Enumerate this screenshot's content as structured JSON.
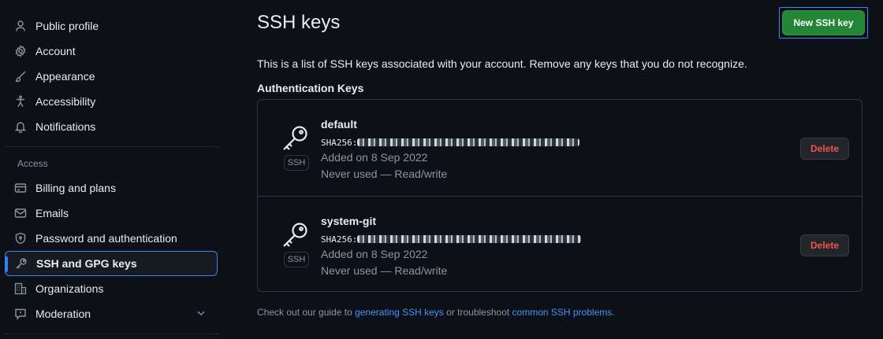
{
  "sidebar": {
    "items": [
      {
        "label": "Public profile",
        "icon": "person-icon"
      },
      {
        "label": "Account",
        "icon": "gear-icon"
      },
      {
        "label": "Appearance",
        "icon": "paintbrush-icon"
      },
      {
        "label": "Accessibility",
        "icon": "accessibility-icon"
      },
      {
        "label": "Notifications",
        "icon": "bell-icon"
      }
    ],
    "access_label": "Access",
    "access_items": [
      {
        "label": "Billing and plans",
        "icon": "credit-card-icon"
      },
      {
        "label": "Emails",
        "icon": "mail-icon"
      },
      {
        "label": "Password and authentication",
        "icon": "shield-lock-icon"
      },
      {
        "label": "SSH and GPG keys",
        "icon": "key-icon",
        "active": true
      },
      {
        "label": "Organizations",
        "icon": "organization-icon"
      },
      {
        "label": "Moderation",
        "icon": "report-icon"
      }
    ]
  },
  "header": {
    "title": "SSH keys",
    "new_key_label": "New SSH key"
  },
  "description": "This is a list of SSH keys associated with your account. Remove any keys that you do not recognize.",
  "auth_keys_title": "Authentication Keys",
  "keys": [
    {
      "name": "default",
      "badge": "SSH",
      "fingerprint_prefix": "SHA256:",
      "added": "Added on 8 Sep 2022",
      "usage": "Never used — Read/write",
      "delete_label": "Delete"
    },
    {
      "name": "system-git",
      "badge": "SSH",
      "fingerprint_prefix": "SHA256:",
      "added": "Added on 8 Sep 2022",
      "usage": "Never used — Read/write",
      "delete_label": "Delete"
    }
  ],
  "footer": {
    "prefix": "Check out our guide to ",
    "link1": "generating SSH keys",
    "middle": " or troubleshoot ",
    "link2": "common SSH problems",
    "suffix": "."
  },
  "colors": {
    "background": "#0d1117",
    "primary_button": "#238636",
    "danger_text": "#f85149",
    "link": "#4493f8",
    "active_indicator": "#2f81f7"
  }
}
